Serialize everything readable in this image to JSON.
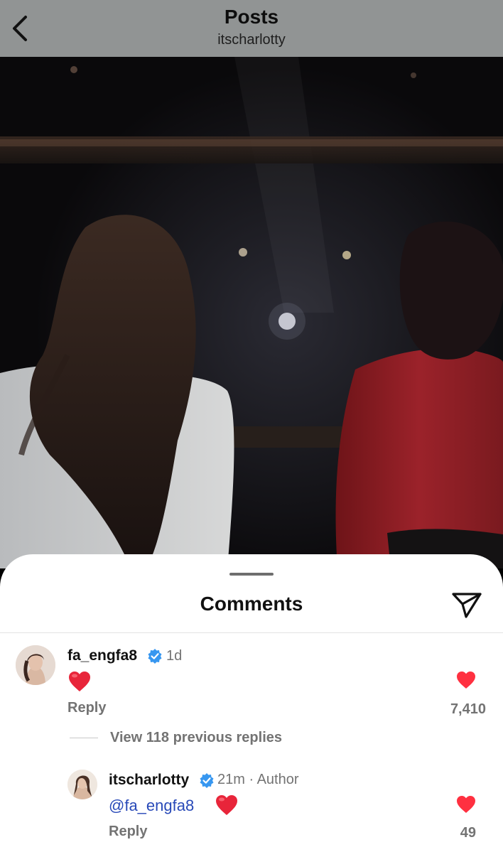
{
  "header": {
    "title": "Posts",
    "subtitle": "itscharlotty"
  },
  "icons": {
    "back": "chevron-left-icon",
    "share": "paper-plane-icon",
    "verified": "verified-badge-icon",
    "heart": "heart-icon"
  },
  "comments_sheet": {
    "title": "Comments",
    "comment": {
      "username": "fa_engfa8",
      "time": "1d",
      "text": "❤️",
      "reply_label": "Reply",
      "likes": "7,410"
    },
    "view_replies": "View 118 previous replies",
    "reply": {
      "username": "itscharlotty",
      "meta": "21m · Author",
      "mention": "@fa_engfa8",
      "text": "❤️",
      "reply_label": "Reply",
      "likes": "49"
    }
  },
  "colors": {
    "header_bg": "#919494",
    "accent_verified": "#3797f0",
    "like_red": "#ff3040",
    "mention_blue": "#2849b8",
    "muted_text": "#737373"
  }
}
